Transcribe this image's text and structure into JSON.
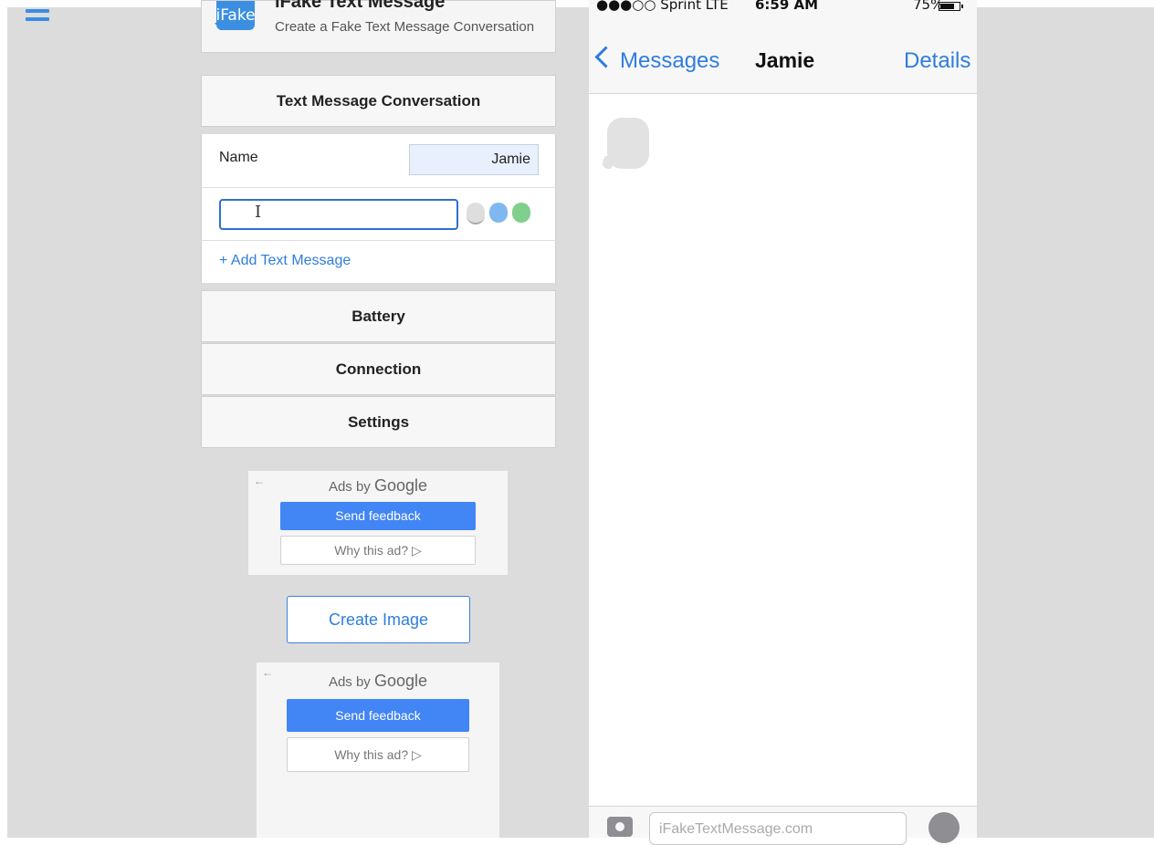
{
  "app": {
    "logo_text": "iFake",
    "title": "iFake Text Message",
    "subtitle": "Create a Fake Text Message Conversation"
  },
  "editor": {
    "conversation_heading": "Text Message Conversation",
    "name_label": "Name",
    "name_value": "Jamie",
    "message_value": "",
    "add_message_label": "+ Add Text Message",
    "battery_heading": "Battery",
    "connection_heading": "Connection",
    "settings_heading": "Settings"
  },
  "ads": [
    {
      "back_icon": "←",
      "ads_by": "Ads by",
      "google": "Google",
      "send_feedback": "Send feedback",
      "why_this_ad": "Why this ad? ▷"
    },
    {
      "back_icon": "←",
      "ads_by": "Ads by",
      "google": "Google",
      "send_feedback": "Send feedback",
      "why_this_ad": "Why this ad? ▷"
    }
  ],
  "create_image_label": "Create Image",
  "phone": {
    "carrier": "●●●○○ Sprint  LTE",
    "time": "6:59 AM",
    "battery_percent": "75%",
    "battery_level": 0.75,
    "back_label": "Messages",
    "contact_name": "Jamie",
    "details_label": "Details",
    "input_placeholder": "iFakeTextMessage.com"
  },
  "colors": {
    "accent_blue": "#2f7ddc",
    "google_blue": "#4285f4",
    "background_gray": "#dcdcdc"
  }
}
